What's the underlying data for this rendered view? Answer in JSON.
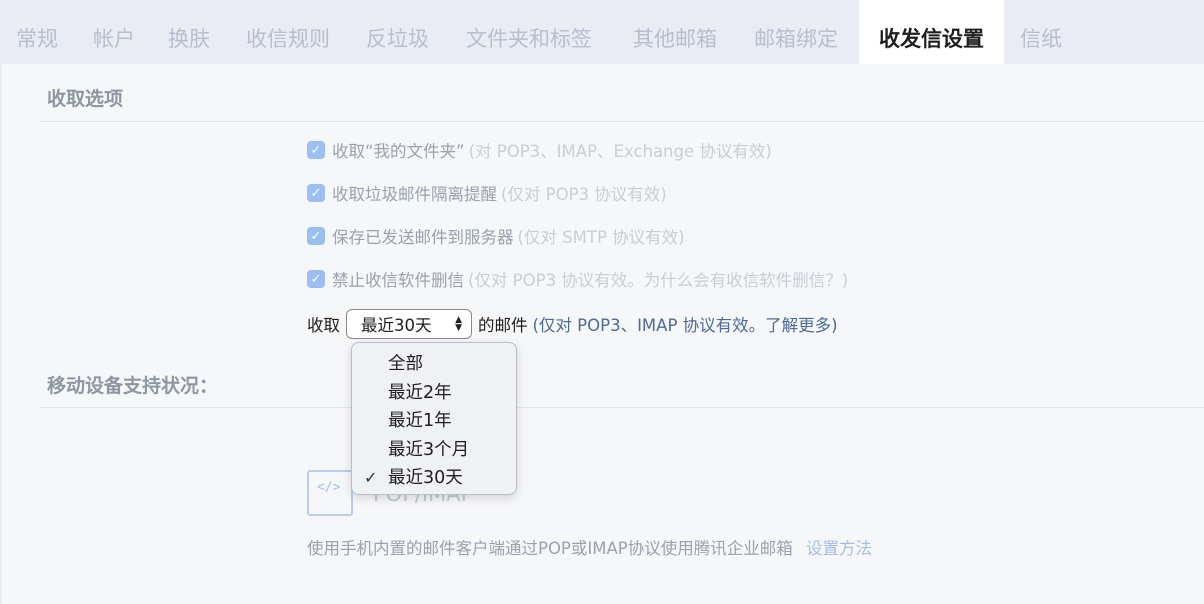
{
  "tabs": [
    {
      "label": "常规",
      "active": false
    },
    {
      "label": "帐户",
      "active": false
    },
    {
      "label": "换肤",
      "active": false
    },
    {
      "label": "收信规则",
      "active": false
    },
    {
      "label": "反垃圾",
      "active": false
    },
    {
      "label": "文件夹和标签",
      "active": false
    },
    {
      "label": "其他邮箱",
      "active": false
    },
    {
      "label": "邮箱绑定",
      "active": false
    },
    {
      "label": "收发信设置",
      "active": true
    },
    {
      "label": "信纸",
      "active": false
    }
  ],
  "receive_section": {
    "title": "收取选项",
    "options": [
      {
        "label": "收取“我的文件夹”",
        "note": "(对 POP3、IMAP、Exchange 协议有效)",
        "checked": true
      },
      {
        "label": "收取垃圾邮件隔离提醒",
        "note": "(仅对 POP3 协议有效)",
        "checked": true
      },
      {
        "label": "保存已发送邮件到服务器",
        "note": "(仅对 SMTP 协议有效)",
        "checked": true
      },
      {
        "label": "禁止收信软件删信",
        "note": "(仅对 POP3 协议有效。为什么会有收信软件删信？)",
        "checked": true
      }
    ],
    "fetch": {
      "prefix": "收取",
      "selected": "最近30天",
      "suffix": "的邮件",
      "note": "(仅对 POP3、IMAP 协议有效。了解更多)"
    },
    "dropdown_options": [
      {
        "label": "全部",
        "selected": false
      },
      {
        "label": "最近2年",
        "selected": false
      },
      {
        "label": "最近1年",
        "selected": false
      },
      {
        "label": "最近3个月",
        "selected": false
      },
      {
        "label": "最近30天",
        "selected": true
      }
    ],
    "check_glyph": "✓"
  },
  "mobile_section": {
    "title": "移动设备支持状况：",
    "imap_icon_text": "</>",
    "imap_title": "POP/IMAP",
    "description": "使用手机内置的邮件客户端通过POP或IMAP协议使用腾讯企业邮箱",
    "setup_link": "设置方法"
  }
}
